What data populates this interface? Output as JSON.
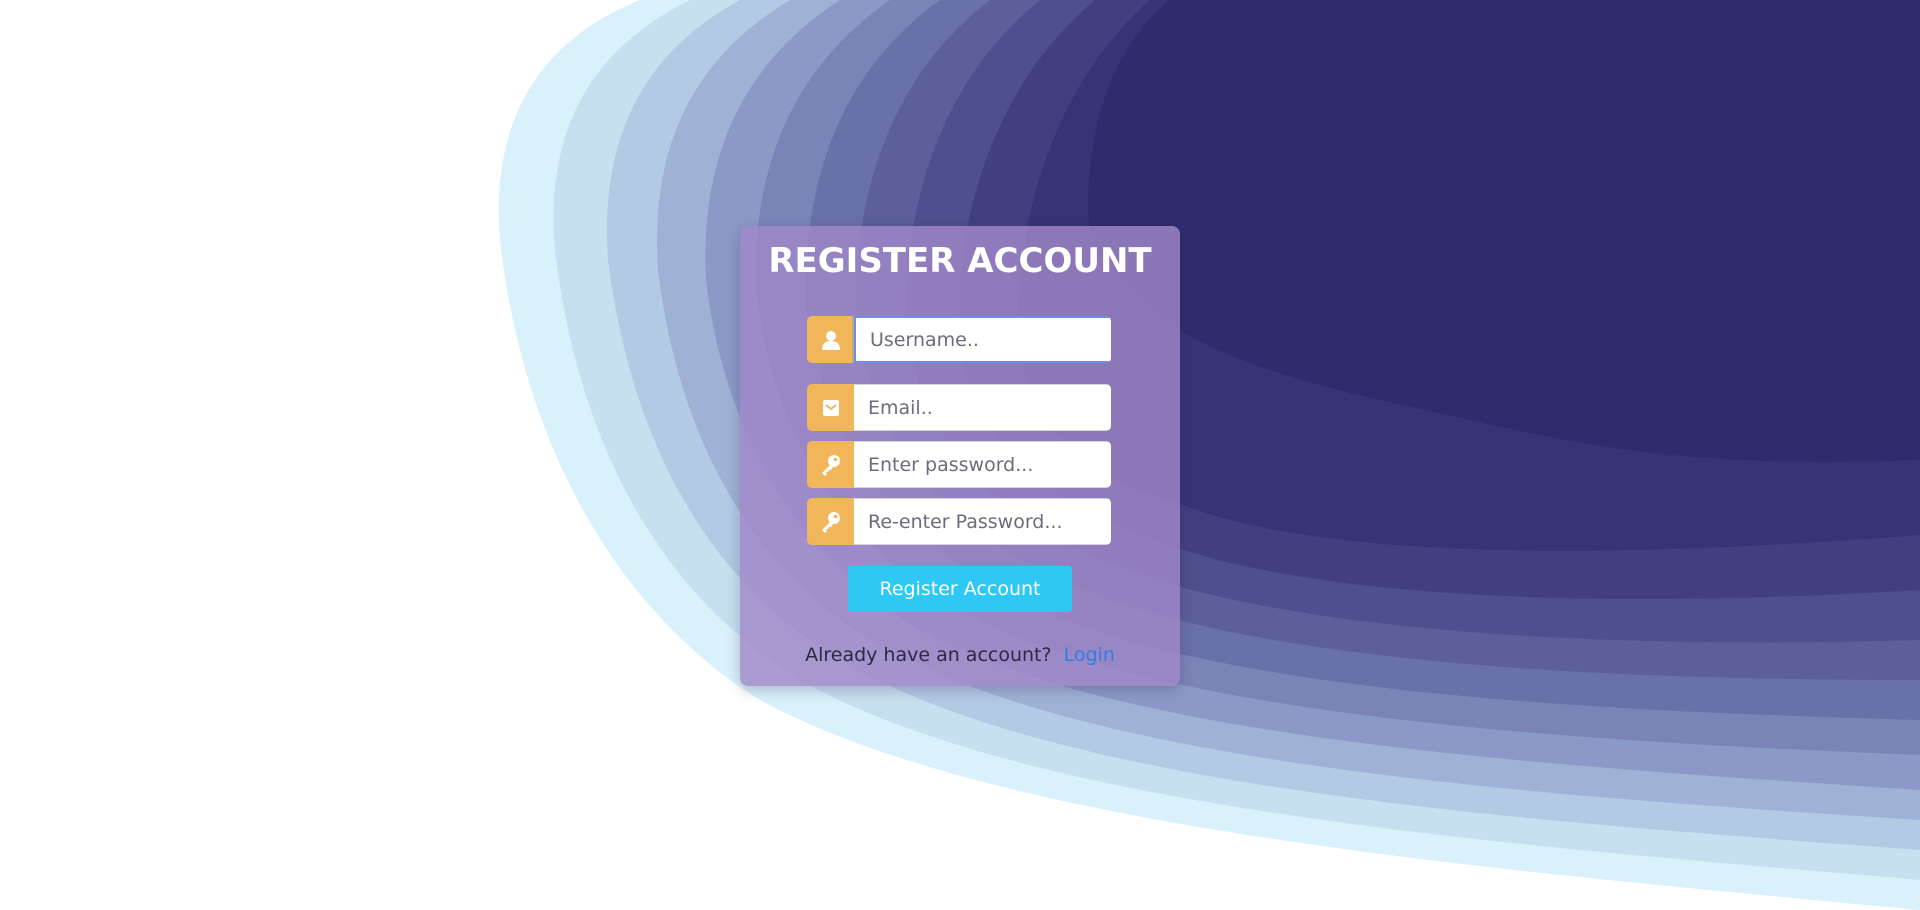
{
  "colors": {
    "card": "#a087c8",
    "icon_addon": "#f2b65a",
    "button": "#2ec8f5",
    "link": "#2f7ee8",
    "wave_dark": "#2f2c6e",
    "wave_light": "#d8f1fb"
  },
  "form": {
    "title": "REGISTER ACCOUNT",
    "fields": [
      {
        "icon": "user-icon",
        "placeholder": "Username..",
        "value": ""
      },
      {
        "icon": "envelope-icon",
        "placeholder": "Email..",
        "value": ""
      },
      {
        "icon": "key-icon",
        "placeholder": "Enter password...",
        "value": ""
      },
      {
        "icon": "key-icon",
        "placeholder": "Re-enter Password...",
        "value": ""
      }
    ],
    "submit_label": "Register Account",
    "login_prompt": "Already have an account?",
    "login_link": "Login"
  }
}
